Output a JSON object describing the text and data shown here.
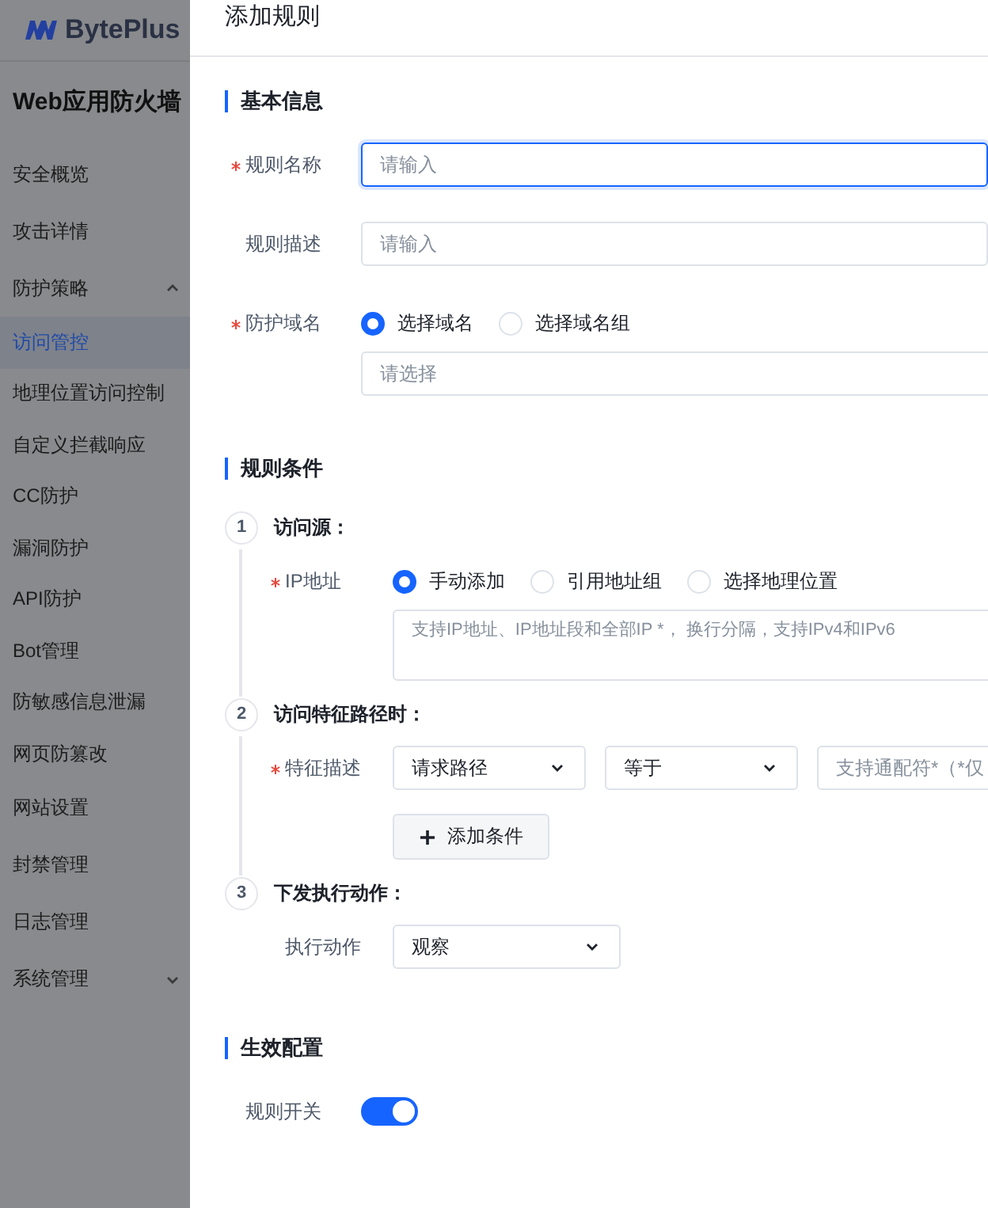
{
  "sidebar": {
    "logo": "BytePlus",
    "title": "Web应用防火墙",
    "items": [
      {
        "label": "安全概览",
        "selected": false
      },
      {
        "label": "攻击详情",
        "selected": false
      },
      {
        "label": "防护策略",
        "selected": false,
        "expanded": true,
        "children": [
          {
            "label": "访问管控",
            "selected": true
          },
          {
            "label": "地理位置访问控制",
            "selected": false
          },
          {
            "label": "自定义拦截响应",
            "selected": false
          },
          {
            "label": "CC防护",
            "selected": false
          },
          {
            "label": "漏洞防护",
            "selected": false
          },
          {
            "label": "API防护",
            "selected": false
          },
          {
            "label": "Bot管理",
            "selected": false
          },
          {
            "label": "防敏感信息泄漏",
            "selected": false
          },
          {
            "label": "网页防篡改",
            "selected": false
          }
        ]
      },
      {
        "label": "网站设置",
        "selected": false
      },
      {
        "label": "封禁管理",
        "selected": false
      },
      {
        "label": "日志管理",
        "selected": false
      },
      {
        "label": "系统管理",
        "selected": false,
        "expanded": false
      }
    ]
  },
  "header": {
    "title": "添加规则"
  },
  "basic_info": {
    "title": "基本信息",
    "fields": [
      {
        "kind": "input",
        "label": "规则名称",
        "required": true,
        "placeholder": "请输入",
        "focused": true
      },
      {
        "kind": "input",
        "label": "规则描述",
        "required": false,
        "placeholder": "请输入",
        "focused": false
      },
      {
        "kind": "radio-select",
        "label": "防护域名",
        "required": true,
        "options": [
          {
            "label": "选择域名",
            "selected": true
          },
          {
            "label": "选择域名组",
            "selected": false
          }
        ],
        "placeholder": "请选择"
      }
    ]
  },
  "rule_conditions": {
    "title": "规则条件",
    "steps": [
      {
        "number": "1",
        "title": "访问源：",
        "fields": [
          {
            "kind": "radio-textarea",
            "label": "IP地址",
            "required": true,
            "options": [
              {
                "label": "手动添加",
                "selected": true
              },
              {
                "label": "引用地址组",
                "selected": false
              },
              {
                "label": "选择地理位置",
                "selected": false
              }
            ],
            "placeholder": "支持IP地址、IP地址段和全部IP *， 换行分隔，支持IPv4和IPv6"
          }
        ]
      },
      {
        "number": "2",
        "title": "访问特征路径时：",
        "fields": [
          {
            "kind": "condition",
            "label": "特征描述",
            "required": true,
            "selects": [
              "请求路径",
              "等于"
            ],
            "placeholder": "支持通配符*（*仅",
            "add_button": "添加条件"
          }
        ]
      },
      {
        "number": "3",
        "title": "下发执行动作：",
        "fields": [
          {
            "kind": "select",
            "label": "执行动作",
            "required": false,
            "value": "观察"
          }
        ]
      }
    ]
  },
  "effective_config": {
    "title": "生效配置",
    "fields": [
      {
        "kind": "switch",
        "label": "规则开关",
        "on": true
      }
    ]
  }
}
